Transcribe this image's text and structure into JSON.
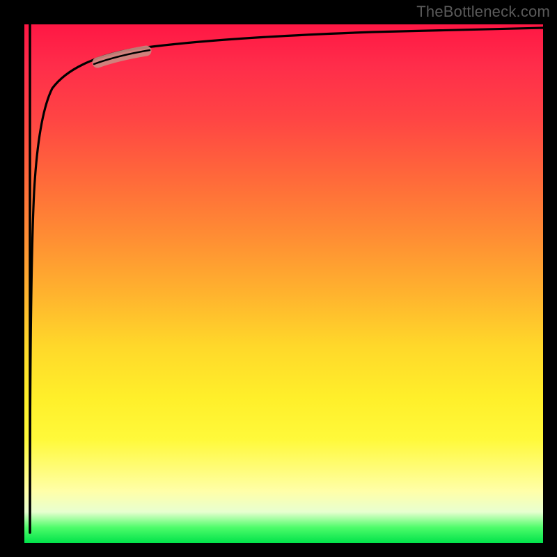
{
  "attribution": "TheBottleneck.com",
  "chart_data": {
    "type": "line",
    "title": "",
    "xlabel": "",
    "ylabel": "",
    "xlim": [
      0,
      100
    ],
    "ylim": [
      0,
      100
    ],
    "series": [
      {
        "name": "bottleneck-curve",
        "x": [
          1.1,
          1.3,
          1.6,
          1.9,
          2.3,
          2.8,
          3.4,
          4.2,
          5.2,
          6.5,
          8.2,
          10.5,
          14,
          19,
          26,
          35,
          46,
          58,
          72,
          86,
          100
        ],
        "values": [
          2,
          30,
          50,
          62,
          70,
          76,
          80.5,
          84,
          86.5,
          88.5,
          90.2,
          91.6,
          92.8,
          93.8,
          94.6,
          95.3,
          95.9,
          96.4,
          96.8,
          97.2,
          97.5
        ]
      },
      {
        "name": "initial-drop",
        "x": [
          1.05,
          1.1
        ],
        "values": [
          100,
          2
        ]
      }
    ],
    "highlight_segment": {
      "series": "bottleneck-curve",
      "x_range": [
        14,
        24
      ],
      "color": "#cc8b82"
    },
    "annotations": []
  }
}
